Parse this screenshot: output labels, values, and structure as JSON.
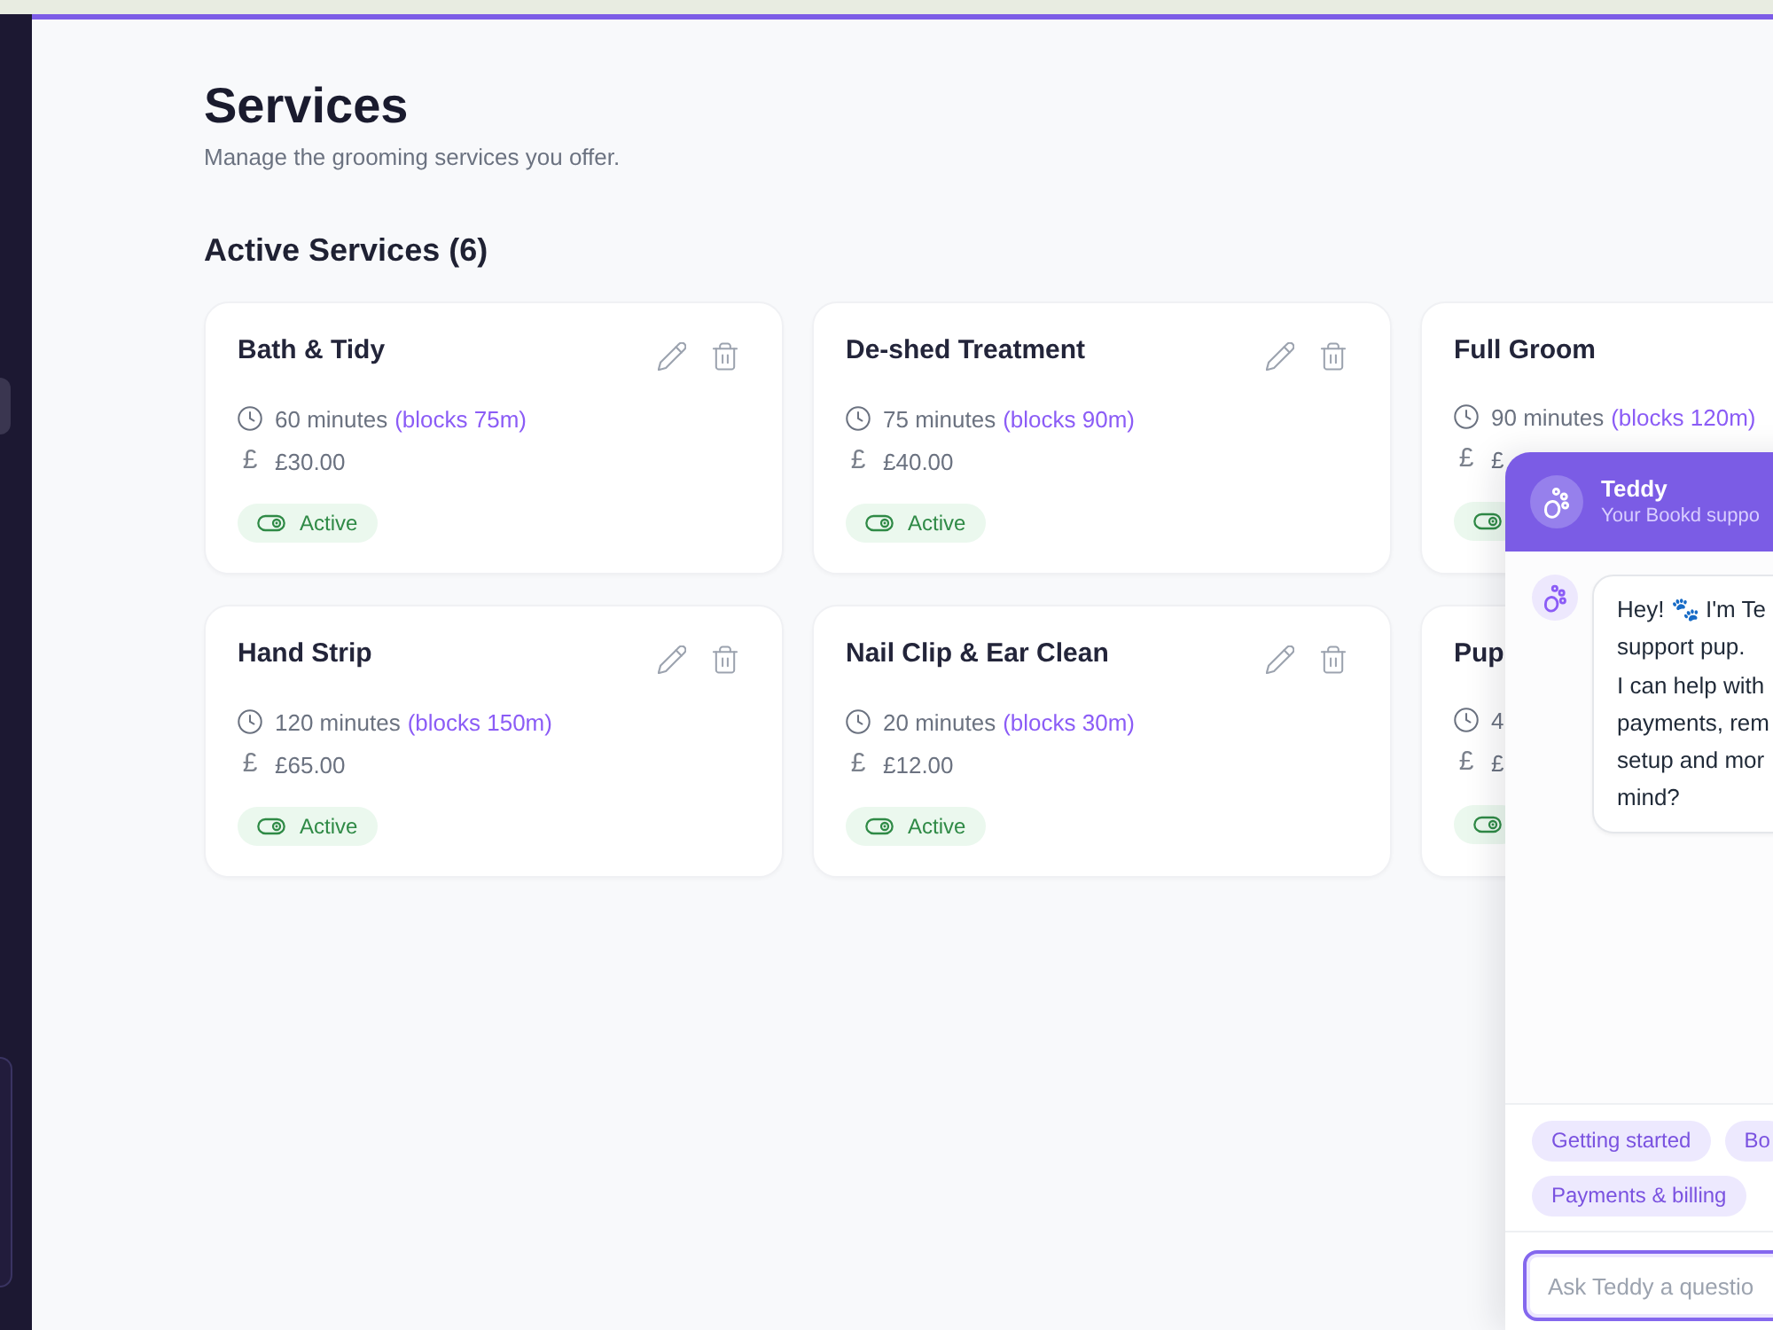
{
  "page": {
    "title": "Services",
    "subtitle": "Manage the grooming services you offer."
  },
  "section": {
    "title": "Active Services (6)"
  },
  "services": [
    {
      "name": "Bath & Tidy",
      "duration": "60 minutes",
      "blocks": "(blocks 75m)",
      "currency": "£",
      "price": "£30.00",
      "status": {
        "active": true,
        "label": "Active"
      },
      "actions": true
    },
    {
      "name": "De-shed Treatment",
      "duration": "75 minutes",
      "blocks": "(blocks 90m)",
      "currency": "£",
      "price": "£40.00",
      "status": {
        "active": true,
        "label": "Active"
      },
      "actions": true
    },
    {
      "name": "Full Groom",
      "duration": "90 minutes",
      "blocks": "(blocks 120m)",
      "currency": "£",
      "price": "£",
      "status": {
        "active": true
      },
      "actions": false
    },
    {
      "name": "Hand Strip",
      "duration": "120 minutes",
      "blocks": "(blocks 150m)",
      "currency": "£",
      "price": "£65.00",
      "status": {
        "active": true,
        "label": "Active"
      },
      "actions": true
    },
    {
      "name": "Nail Clip & Ear Clean",
      "duration": "20 minutes",
      "blocks": "(blocks 30m)",
      "currency": "£",
      "price": "£12.00",
      "status": {
        "active": true,
        "label": "Active"
      },
      "actions": true
    },
    {
      "name": "Pup",
      "duration": "4",
      "currency": "£",
      "price": "£",
      "status": {
        "active": true
      },
      "actions": false
    }
  ],
  "chat": {
    "name": "Teddy",
    "tagline": "Your Bookd suppo",
    "messages": [
      {
        "kind": "bot",
        "text": "Hey! 🐾 I'm Te\nsupport pup.\nI can help with\npayments, rem\nsetup and mor\nmind?"
      }
    ],
    "quick_replies": [
      [
        {
          "label": "Getting started"
        },
        {
          "label": "Bo"
        }
      ],
      [
        {
          "label": "Payments & billing"
        }
      ]
    ],
    "input": {
      "placeholder": "Ask Teddy a questio"
    }
  }
}
